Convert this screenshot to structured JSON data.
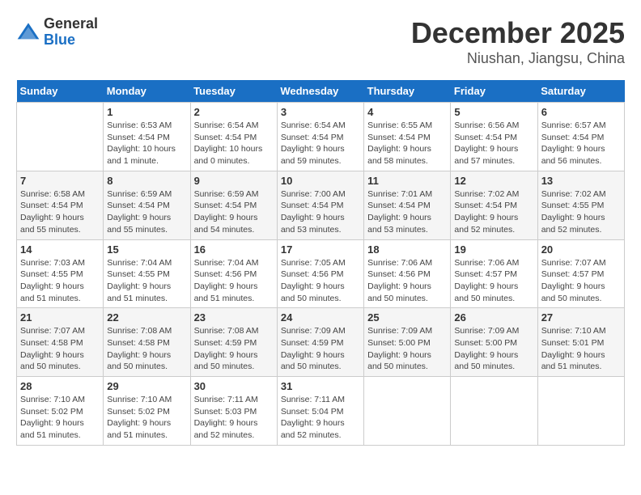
{
  "header": {
    "logo": {
      "general": "General",
      "blue": "Blue"
    },
    "month": "December 2025",
    "location": "Niushan, Jiangsu, China"
  },
  "days_of_week": [
    "Sunday",
    "Monday",
    "Tuesday",
    "Wednesday",
    "Thursday",
    "Friday",
    "Saturday"
  ],
  "weeks": [
    [
      {
        "day": "",
        "sunrise": "",
        "sunset": "",
        "daylight": ""
      },
      {
        "day": "1",
        "sunrise": "Sunrise: 6:53 AM",
        "sunset": "Sunset: 4:54 PM",
        "daylight": "Daylight: 10 hours and 1 minute."
      },
      {
        "day": "2",
        "sunrise": "Sunrise: 6:54 AM",
        "sunset": "Sunset: 4:54 PM",
        "daylight": "Daylight: 10 hours and 0 minutes."
      },
      {
        "day": "3",
        "sunrise": "Sunrise: 6:54 AM",
        "sunset": "Sunset: 4:54 PM",
        "daylight": "Daylight: 9 hours and 59 minutes."
      },
      {
        "day": "4",
        "sunrise": "Sunrise: 6:55 AM",
        "sunset": "Sunset: 4:54 PM",
        "daylight": "Daylight: 9 hours and 58 minutes."
      },
      {
        "day": "5",
        "sunrise": "Sunrise: 6:56 AM",
        "sunset": "Sunset: 4:54 PM",
        "daylight": "Daylight: 9 hours and 57 minutes."
      },
      {
        "day": "6",
        "sunrise": "Sunrise: 6:57 AM",
        "sunset": "Sunset: 4:54 PM",
        "daylight": "Daylight: 9 hours and 56 minutes."
      }
    ],
    [
      {
        "day": "7",
        "sunrise": "Sunrise: 6:58 AM",
        "sunset": "Sunset: 4:54 PM",
        "daylight": "Daylight: 9 hours and 55 minutes."
      },
      {
        "day": "8",
        "sunrise": "Sunrise: 6:59 AM",
        "sunset": "Sunset: 4:54 PM",
        "daylight": "Daylight: 9 hours and 55 minutes."
      },
      {
        "day": "9",
        "sunrise": "Sunrise: 6:59 AM",
        "sunset": "Sunset: 4:54 PM",
        "daylight": "Daylight: 9 hours and 54 minutes."
      },
      {
        "day": "10",
        "sunrise": "Sunrise: 7:00 AM",
        "sunset": "Sunset: 4:54 PM",
        "daylight": "Daylight: 9 hours and 53 minutes."
      },
      {
        "day": "11",
        "sunrise": "Sunrise: 7:01 AM",
        "sunset": "Sunset: 4:54 PM",
        "daylight": "Daylight: 9 hours and 53 minutes."
      },
      {
        "day": "12",
        "sunrise": "Sunrise: 7:02 AM",
        "sunset": "Sunset: 4:54 PM",
        "daylight": "Daylight: 9 hours and 52 minutes."
      },
      {
        "day": "13",
        "sunrise": "Sunrise: 7:02 AM",
        "sunset": "Sunset: 4:55 PM",
        "daylight": "Daylight: 9 hours and 52 minutes."
      }
    ],
    [
      {
        "day": "14",
        "sunrise": "Sunrise: 7:03 AM",
        "sunset": "Sunset: 4:55 PM",
        "daylight": "Daylight: 9 hours and 51 minutes."
      },
      {
        "day": "15",
        "sunrise": "Sunrise: 7:04 AM",
        "sunset": "Sunset: 4:55 PM",
        "daylight": "Daylight: 9 hours and 51 minutes."
      },
      {
        "day": "16",
        "sunrise": "Sunrise: 7:04 AM",
        "sunset": "Sunset: 4:56 PM",
        "daylight": "Daylight: 9 hours and 51 minutes."
      },
      {
        "day": "17",
        "sunrise": "Sunrise: 7:05 AM",
        "sunset": "Sunset: 4:56 PM",
        "daylight": "Daylight: 9 hours and 50 minutes."
      },
      {
        "day": "18",
        "sunrise": "Sunrise: 7:06 AM",
        "sunset": "Sunset: 4:56 PM",
        "daylight": "Daylight: 9 hours and 50 minutes."
      },
      {
        "day": "19",
        "sunrise": "Sunrise: 7:06 AM",
        "sunset": "Sunset: 4:57 PM",
        "daylight": "Daylight: 9 hours and 50 minutes."
      },
      {
        "day": "20",
        "sunrise": "Sunrise: 7:07 AM",
        "sunset": "Sunset: 4:57 PM",
        "daylight": "Daylight: 9 hours and 50 minutes."
      }
    ],
    [
      {
        "day": "21",
        "sunrise": "Sunrise: 7:07 AM",
        "sunset": "Sunset: 4:58 PM",
        "daylight": "Daylight: 9 hours and 50 minutes."
      },
      {
        "day": "22",
        "sunrise": "Sunrise: 7:08 AM",
        "sunset": "Sunset: 4:58 PM",
        "daylight": "Daylight: 9 hours and 50 minutes."
      },
      {
        "day": "23",
        "sunrise": "Sunrise: 7:08 AM",
        "sunset": "Sunset: 4:59 PM",
        "daylight": "Daylight: 9 hours and 50 minutes."
      },
      {
        "day": "24",
        "sunrise": "Sunrise: 7:09 AM",
        "sunset": "Sunset: 4:59 PM",
        "daylight": "Daylight: 9 hours and 50 minutes."
      },
      {
        "day": "25",
        "sunrise": "Sunrise: 7:09 AM",
        "sunset": "Sunset: 5:00 PM",
        "daylight": "Daylight: 9 hours and 50 minutes."
      },
      {
        "day": "26",
        "sunrise": "Sunrise: 7:09 AM",
        "sunset": "Sunset: 5:00 PM",
        "daylight": "Daylight: 9 hours and 50 minutes."
      },
      {
        "day": "27",
        "sunrise": "Sunrise: 7:10 AM",
        "sunset": "Sunset: 5:01 PM",
        "daylight": "Daylight: 9 hours and 51 minutes."
      }
    ],
    [
      {
        "day": "28",
        "sunrise": "Sunrise: 7:10 AM",
        "sunset": "Sunset: 5:02 PM",
        "daylight": "Daylight: 9 hours and 51 minutes."
      },
      {
        "day": "29",
        "sunrise": "Sunrise: 7:10 AM",
        "sunset": "Sunset: 5:02 PM",
        "daylight": "Daylight: 9 hours and 51 minutes."
      },
      {
        "day": "30",
        "sunrise": "Sunrise: 7:11 AM",
        "sunset": "Sunset: 5:03 PM",
        "daylight": "Daylight: 9 hours and 52 minutes."
      },
      {
        "day": "31",
        "sunrise": "Sunrise: 7:11 AM",
        "sunset": "Sunset: 5:04 PM",
        "daylight": "Daylight: 9 hours and 52 minutes."
      },
      {
        "day": "",
        "sunrise": "",
        "sunset": "",
        "daylight": ""
      },
      {
        "day": "",
        "sunrise": "",
        "sunset": "",
        "daylight": ""
      },
      {
        "day": "",
        "sunrise": "",
        "sunset": "",
        "daylight": ""
      }
    ]
  ]
}
